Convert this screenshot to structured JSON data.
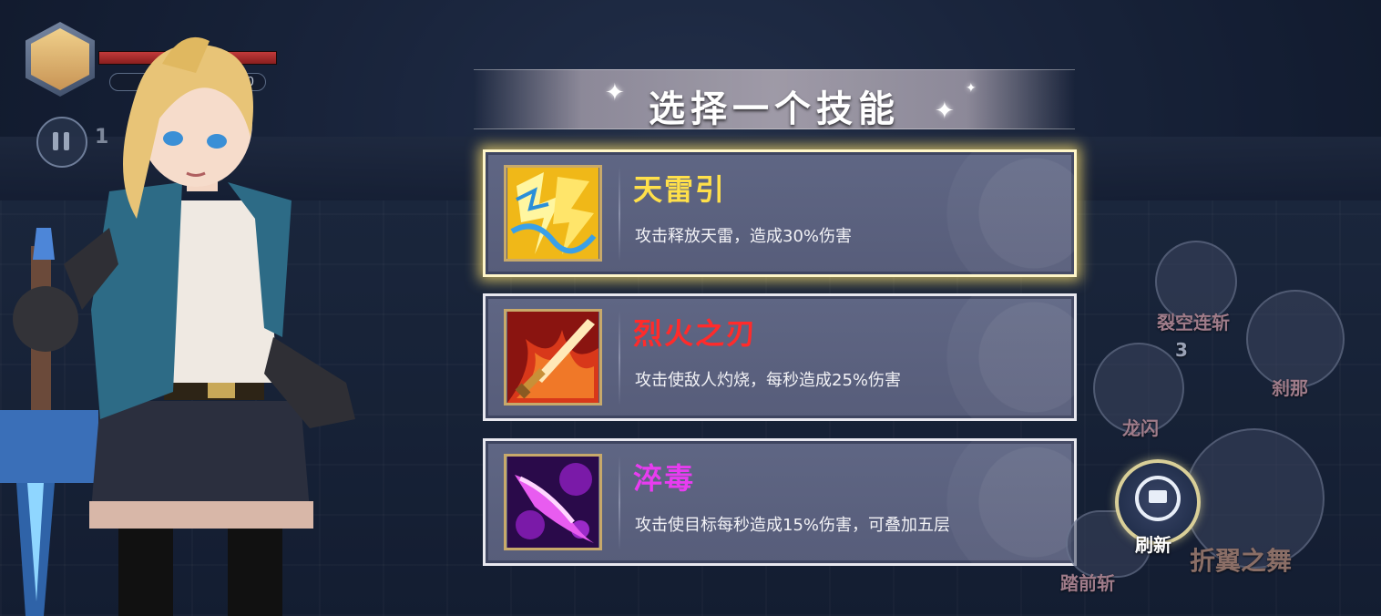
{
  "hud": {
    "hp_fraction": 1.0,
    "score_text": "2490",
    "wave_text": "1"
  },
  "dialog": {
    "title": "选择一个技能",
    "skills": [
      {
        "name": "天雷引",
        "description": "攻击释放天雷，造成30%伤害",
        "name_color": "#ffe04a",
        "icon": "lightning-icon",
        "selected": true
      },
      {
        "name": "烈火之刃",
        "description": "攻击使敌人灼烧，每秒造成25%伤害",
        "name_color": "#ff2b2b",
        "icon": "flame-sword-icon",
        "selected": false
      },
      {
        "name": "淬毒",
        "description": "攻击使目标每秒造成15%伤害，可叠加五层",
        "name_color": "#e83cf0",
        "icon": "poison-blade-icon",
        "selected": false
      }
    ]
  },
  "skill_buttons": {
    "skill_1": "裂空连斩",
    "skill_2": "刹那",
    "skill_3": "龙闪",
    "skill_3_count": "3",
    "skill_4": "踏前斩",
    "skill_5": "折翼之舞"
  },
  "refresh_button": {
    "label": "刷新"
  },
  "colors": {
    "accent_gold": "#e8d38a",
    "card_bg": "#5b6180"
  }
}
